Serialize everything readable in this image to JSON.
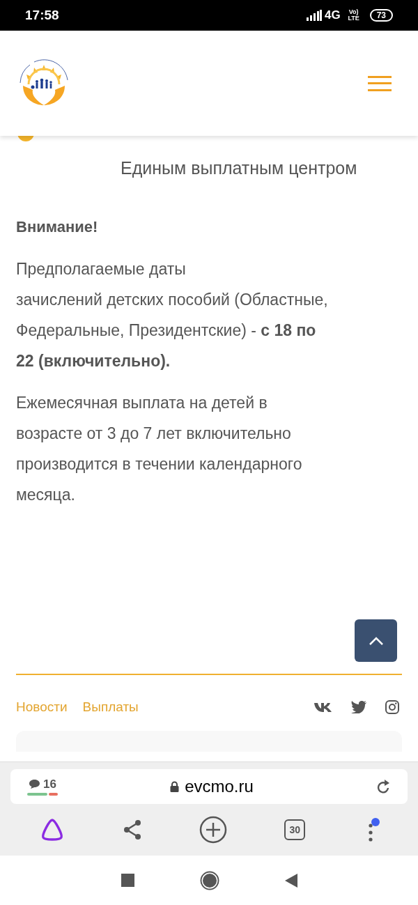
{
  "status_bar": {
    "time": "17:58",
    "network": "4G",
    "volte": "Vo) LTE",
    "battery": "73"
  },
  "header": {
    "menu_open": false
  },
  "article_title": {
    "lines": [
      "Единым выплатным центром"
    ]
  },
  "notice": {
    "heading": "Внимание!",
    "paragraphs": [
      {
        "lines": [
          "Предполагаемые даты",
          "зачислений детских пособий (Областные,",
          "Федеральные, Президентские) - **с 18 по**",
          "**22 (включительно).**"
        ]
      },
      {
        "lines": [
          "Ежемесячная выплата на детей в",
          "возрасте от 3 до 7 лет включительно",
          "производится в течении календарного",
          "месяца."
        ]
      }
    ]
  },
  "footer": {
    "links": [
      {
        "label": "Новости"
      },
      {
        "label": "Выплаты"
      }
    ],
    "social": [
      {
        "kind": "vk"
      },
      {
        "kind": "twitter"
      },
      {
        "kind": "instagram"
      }
    ]
  },
  "browser": {
    "comments": "16",
    "url": "evcmo.ru",
    "tabs": "30",
    "menu_notification": true
  }
}
